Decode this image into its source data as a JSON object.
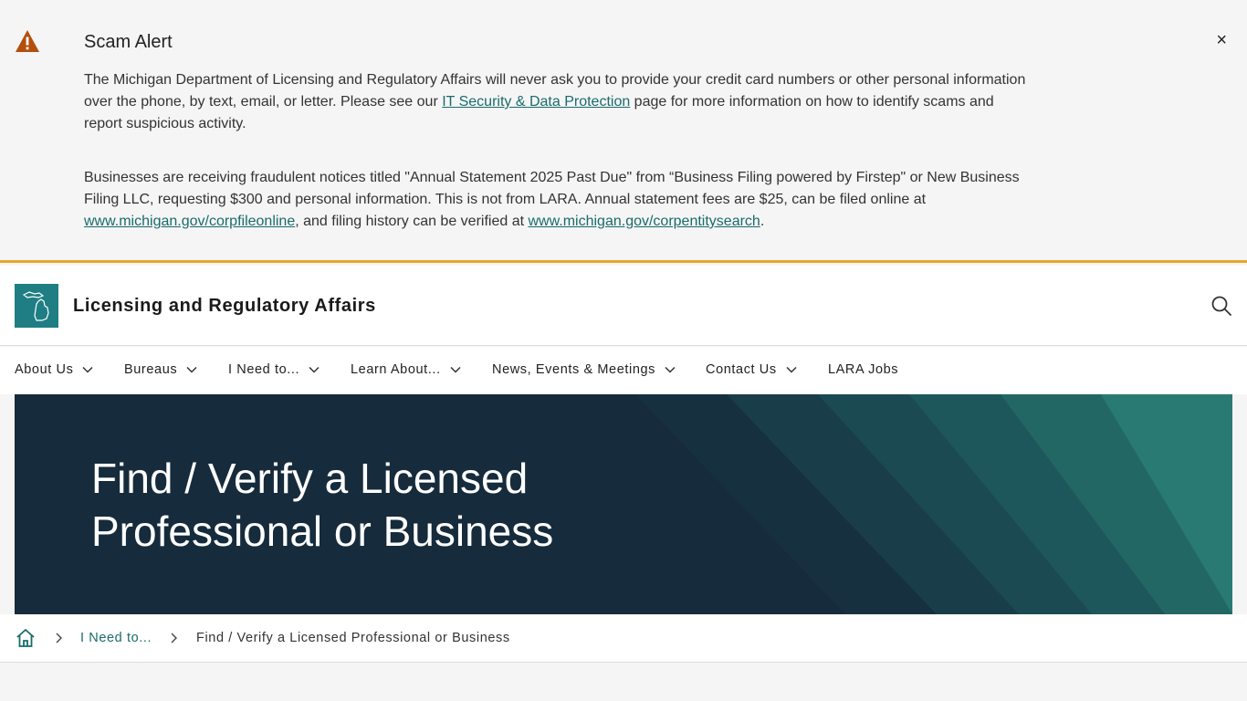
{
  "alert": {
    "title": "Scam Alert",
    "close_label": "×",
    "p1_before": "The Michigan Department of Licensing and Regulatory Affairs will never ask you to provide your credit card numbers or other personal information over the phone, by text, email, or letter. Please see our ",
    "p1_link": "IT Security & Data Protection",
    "p1_after": " page for more information on how to identify scams and report suspicious activity.",
    "p2_before": "Businesses are receiving fraudulent notices titled \"Annual Statement 2025 Past Due\" from “Business Filing powered by Firstep\" or New Business Filing LLC, requesting $300 and personal information. This is not from LARA. Annual statement fees are $25, can be filed online at ",
    "p2_link1": "www.michigan.gov/corpfileonline",
    "p2_mid": ", and filing history can be verified at ",
    "p2_link2": "www.michigan.gov/corpentitysearch",
    "p2_after": "."
  },
  "header": {
    "title": "Licensing and Regulatory Affairs"
  },
  "nav": {
    "items": [
      {
        "label": "About Us"
      },
      {
        "label": "Bureaus"
      },
      {
        "label": "I Need to..."
      },
      {
        "label": "Learn About..."
      },
      {
        "label": "News, Events & Meetings"
      },
      {
        "label": "Contact Us"
      },
      {
        "label": "LARA Jobs"
      }
    ]
  },
  "hero": {
    "title": "Find / Verify a Licensed Professional or Business"
  },
  "breadcrumb": {
    "link": "I Need to...",
    "current": "Find / Verify a Licensed Professional or Business"
  },
  "colors": {
    "accent": "#1e7e84",
    "alert_border": "#e6a72a",
    "hero_bg": "#162b3b",
    "link": "#1a6b6b"
  }
}
